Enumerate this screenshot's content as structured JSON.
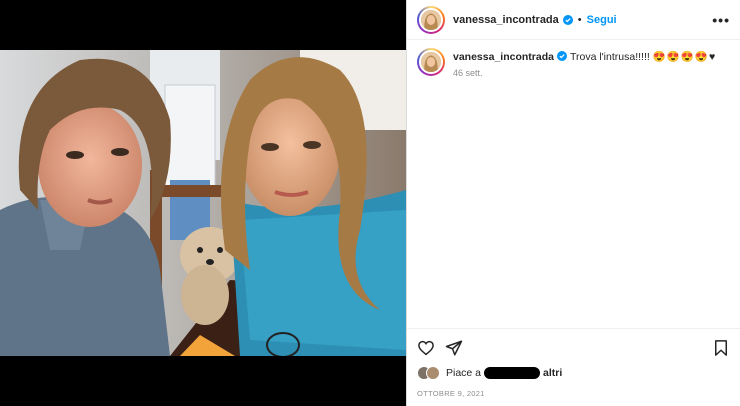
{
  "post": {
    "username": "vanessa_incontrada",
    "follow_label": "Segui",
    "separator": "•",
    "more_label": "•••",
    "caption_text": "Trova l'intrusa!!!!!",
    "caption_emojis": "😍😍😍😍♥",
    "relative_time": "46 sett.",
    "likes_prefix": "Piace a",
    "likes_suffix": "altri",
    "date": "OTTOBRE 9, 2021"
  },
  "icons": {
    "verified": "verified-badge-icon",
    "like": "heart-icon",
    "share": "paper-plane-icon",
    "save": "bookmark-icon",
    "more": "more-options-icon"
  },
  "colors": {
    "accent": "#0095f6",
    "verified": "#0095f6",
    "muted": "#8e8e8e"
  }
}
